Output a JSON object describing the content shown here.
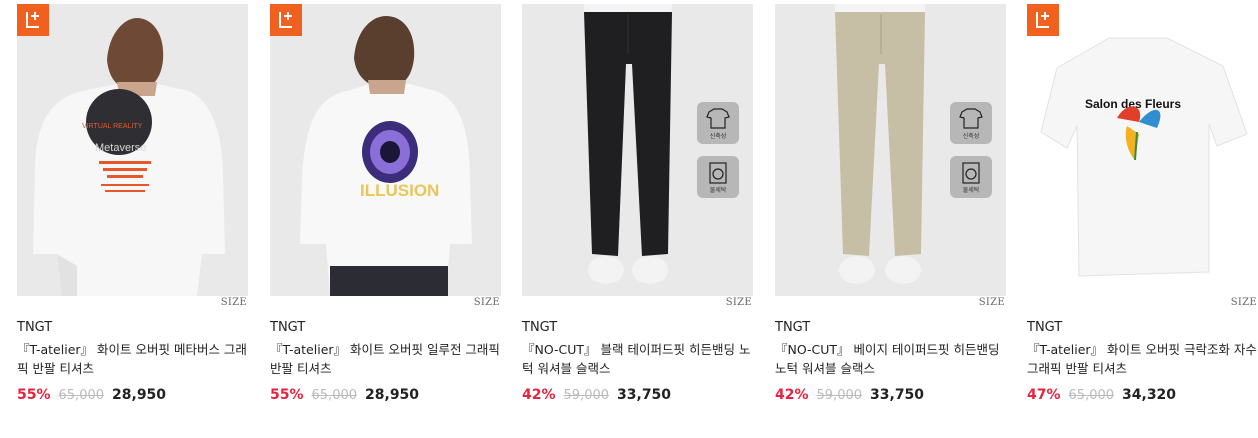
{
  "size_label": "SIZE",
  "colors": {
    "badge": "#f0601e",
    "discount": "#e8233f"
  },
  "products": [
    {
      "brand": "TNGT",
      "title": "『T-atelier』 화이트 오버핏 메타버스 그래픽 반팔 티셔츠",
      "discount": "55%",
      "original_price": "65,000",
      "price": "28,950",
      "print": [
        "VIRTUAL REALITY",
        "Metaverse"
      ]
    },
    {
      "brand": "TNGT",
      "title": "『T-atelier』 화이트 오버핏 일루전 그래픽 반팔 티셔츠",
      "discount": "55%",
      "original_price": "65,000",
      "price": "28,950",
      "print": [
        "ILLUSION"
      ]
    },
    {
      "brand": "TNGT",
      "title": "『NO-CUT』 블랙 테이퍼드핏 히든밴딩 노턱 워셔블 슬랙스",
      "discount": "42%",
      "original_price": "59,000",
      "price": "33,750",
      "care_labels": [
        "신축성",
        "물세탁"
      ]
    },
    {
      "brand": "TNGT",
      "title": "『NO-CUT』 베이지 테이퍼드핏 히든밴딩 노턱 워셔블 슬랙스",
      "discount": "42%",
      "original_price": "59,000",
      "price": "33,750",
      "care_labels": [
        "신축성",
        "물세탁"
      ]
    },
    {
      "brand": "TNGT",
      "title": "『T-atelier』 화이트 오버핏 극락조화 자수 그래픽 반팔 티셔츠",
      "discount": "47%",
      "original_price": "65,000",
      "price": "34,320",
      "print": [
        "Salon des Fleurs"
      ]
    }
  ]
}
